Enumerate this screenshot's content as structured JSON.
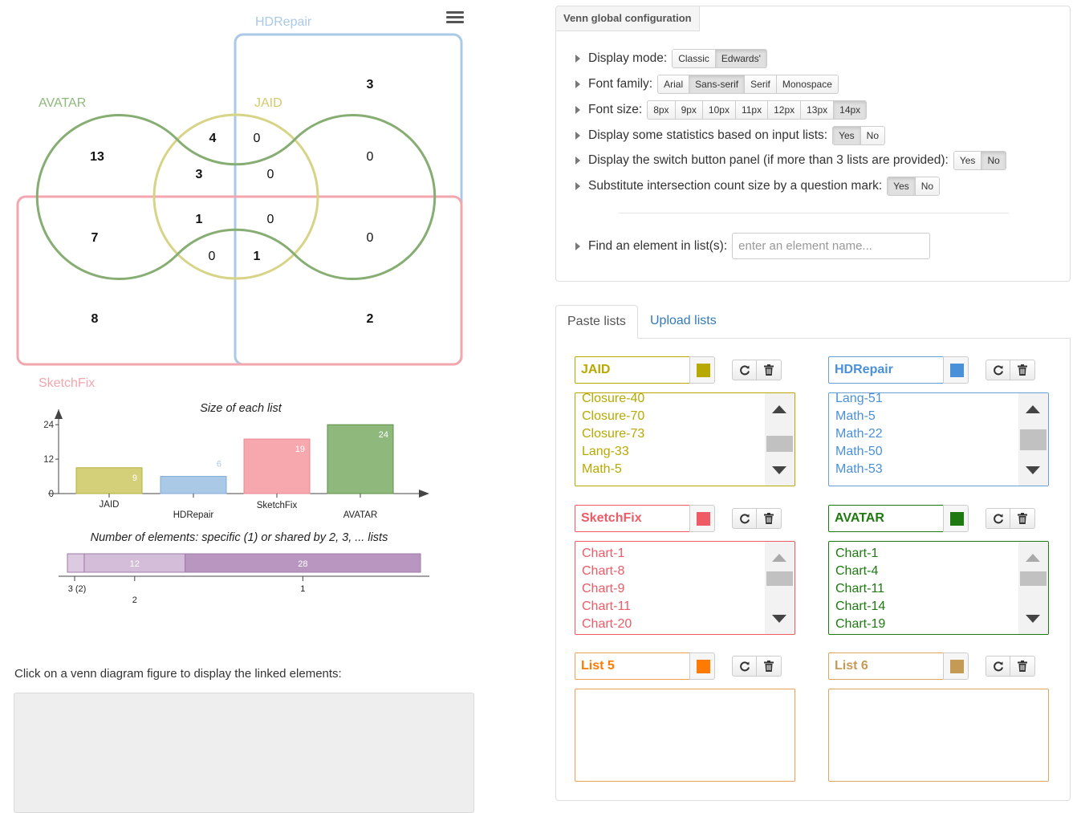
{
  "venn": {
    "sets": [
      {
        "name": "HDRepair",
        "color": "#a9c9e6"
      },
      {
        "name": "AVATAR",
        "color": "#8fb87c"
      },
      {
        "name": "JAID",
        "color": "#c8c35a"
      },
      {
        "name": "SketchFix",
        "color": "#f3a6ad"
      }
    ],
    "counts": [
      "3",
      "13",
      "4",
      "0",
      "0",
      "3",
      "0",
      "7",
      "1",
      "0",
      "0",
      "0",
      "1",
      "8",
      "2"
    ]
  },
  "stats": {
    "bar_title": "Size of each list",
    "y_ticks": [
      "24",
      "12",
      "0"
    ],
    "shared_title": "Number of elements: specific (1) or shared by 2, 3, ... lists",
    "shared_tick_labels": [
      "3 (2)",
      "2",
      "1"
    ]
  },
  "chart_data": [
    {
      "type": "bar",
      "title": "Size of each list",
      "categories": [
        "JAID",
        "HDRepair",
        "SketchFix",
        "AVATAR"
      ],
      "values": [
        9,
        6,
        19,
        24
      ],
      "colors": [
        "#d4d07a",
        "#a9c9e6",
        "#f7a7ae",
        "#8fb87c"
      ],
      "ylim": [
        0,
        26
      ],
      "y_ticks": [
        0,
        12,
        24
      ]
    },
    {
      "type": "bar",
      "title": "Number of elements: specific (1) or shared by 2, 3, ... lists",
      "categories": [
        "3 (2)",
        "2",
        "1"
      ],
      "values": [
        2,
        12,
        28
      ],
      "labels": [
        "",
        "12",
        "28"
      ],
      "colors": [
        "#dccbe0",
        "#d4bdd8",
        "#b996bf"
      ]
    }
  ],
  "bottom": {
    "click_info": "Click on a venn diagram figure to display the linked elements:"
  },
  "config": {
    "title": "Venn global configuration",
    "display_mode": {
      "label": "Display mode:",
      "options": [
        "Classic",
        "Edwards'"
      ],
      "active": 1
    },
    "font_family": {
      "label": "Font family:",
      "options": [
        "Arial",
        "Sans-serif",
        "Serif",
        "Monospace"
      ],
      "active": 1
    },
    "font_size": {
      "label": "Font size:",
      "options": [
        "8px",
        "9px",
        "10px",
        "11px",
        "12px",
        "13px",
        "14px"
      ],
      "active": 6
    },
    "stats": {
      "label": "Display some statistics based on input lists:",
      "options": [
        "Yes",
        "No"
      ],
      "active": 0
    },
    "switch_panel": {
      "label": "Display the switch button panel (if more than 3 lists are provided):",
      "options": [
        "Yes",
        "No"
      ],
      "active": 1
    },
    "question_mark": {
      "label": "Substitute intersection count size by a question mark:",
      "options": [
        "Yes",
        "No"
      ],
      "active": 0
    },
    "find": {
      "label": "Find an element in list(s):",
      "placeholder": "enter an element name..."
    }
  },
  "tabs": {
    "paste": "Paste lists",
    "upload": "Upload lists"
  },
  "lists": [
    {
      "name": "JAID",
      "color": "#b8a900",
      "border": "#b8a900",
      "items": [
        "Closure-40",
        "Closure-70",
        "Closure-73",
        "Lang-33",
        "Math-5"
      ]
    },
    {
      "name": "HDRepair",
      "color": "#4a90d9",
      "border": "#6a9fd4",
      "items": [
        "Lang-51",
        "Math-5",
        "Math-22",
        "Math-50",
        "Math-53"
      ]
    },
    {
      "name": "SketchFix",
      "color": "#ee5a65",
      "border": "#ee5a65",
      "items": [
        "Chart-1",
        "Chart-8",
        "Chart-9",
        "Chart-11",
        "Chart-20"
      ]
    },
    {
      "name": "AVATAR",
      "color": "#1e7a10",
      "border": "#1e7a10",
      "items": [
        "Chart-1",
        "Chart-4",
        "Chart-11",
        "Chart-14",
        "Chart-19"
      ]
    },
    {
      "name": "List 5",
      "color": "#ff7a00",
      "border": "#f0a050",
      "items": []
    },
    {
      "name": "List 6",
      "color": "#c49a55",
      "border": "#d9a860",
      "items": []
    }
  ]
}
